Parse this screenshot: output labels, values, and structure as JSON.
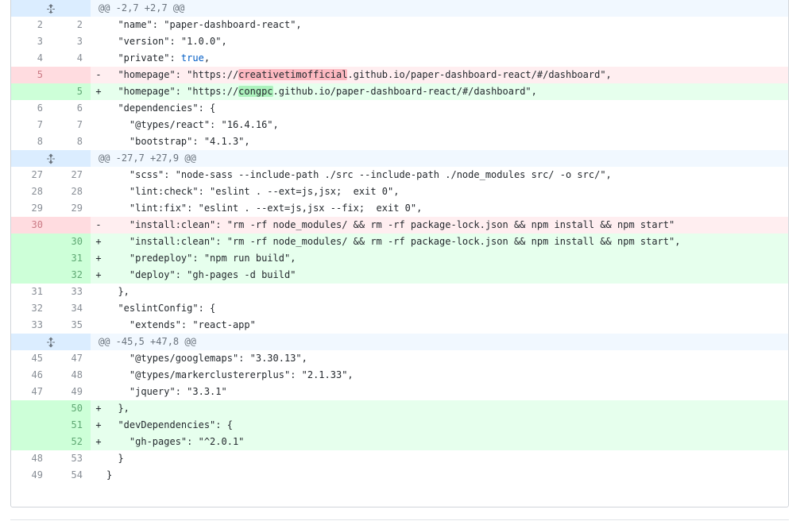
{
  "hunks": [
    {
      "header": "@@ -2,7 +2,7 @@",
      "expand_icon": "unfold-up-icon",
      "lines": [
        {
          "type": "ctx",
          "old": "2",
          "new": "2",
          "code": "  \"name\": \"paper-dashboard-react\","
        },
        {
          "type": "ctx",
          "old": "3",
          "new": "3",
          "code": "  \"version\": \"1.0.0\","
        },
        {
          "type": "ctx",
          "old": "4",
          "new": "4",
          "code": "  \"private\": true,"
        },
        {
          "type": "del",
          "old": "5",
          "new": "",
          "pre": "  \"homepage\": \"https://",
          "word": "creativetimofficial",
          "post": ".github.io/paper-dashboard-react/#/dashboard\","
        },
        {
          "type": "add",
          "old": "",
          "new": "5",
          "pre": "  \"homepage\": \"https://",
          "word": "congpc",
          "post": ".github.io/paper-dashboard-react/#/dashboard\","
        },
        {
          "type": "ctx",
          "old": "6",
          "new": "6",
          "code": "  \"dependencies\": {"
        },
        {
          "type": "ctx",
          "old": "7",
          "new": "7",
          "code": "    \"@types/react\": \"16.4.16\","
        },
        {
          "type": "ctx",
          "old": "8",
          "new": "8",
          "code": "    \"bootstrap\": \"4.1.3\","
        }
      ]
    },
    {
      "header": "@@ -27,7 +27,9 @@",
      "expand_icon": "unfold-icon",
      "lines": [
        {
          "type": "ctx",
          "old": "27",
          "new": "27",
          "code": "    \"scss\": \"node-sass --include-path ./src --include-path ./node_modules src/ -o src/\","
        },
        {
          "type": "ctx",
          "old": "28",
          "new": "28",
          "code": "    \"lint:check\": \"eslint . --ext=js,jsx;  exit 0\","
        },
        {
          "type": "ctx",
          "old": "29",
          "new": "29",
          "code": "    \"lint:fix\": \"eslint . --ext=js,jsx --fix;  exit 0\","
        },
        {
          "type": "del",
          "old": "30",
          "new": "",
          "code": "    \"install:clean\": \"rm -rf node_modules/ && rm -rf package-lock.json && npm install && npm start\""
        },
        {
          "type": "add",
          "old": "",
          "new": "30",
          "code": "    \"install:clean\": \"rm -rf node_modules/ && rm -rf package-lock.json && npm install && npm start\","
        },
        {
          "type": "add",
          "old": "",
          "new": "31",
          "code": "    \"predeploy\": \"npm run build\","
        },
        {
          "type": "add",
          "old": "",
          "new": "32",
          "code": "    \"deploy\": \"gh-pages -d build\""
        },
        {
          "type": "ctx",
          "old": "31",
          "new": "33",
          "code": "  },"
        },
        {
          "type": "ctx",
          "old": "32",
          "new": "34",
          "code": "  \"eslintConfig\": {"
        },
        {
          "type": "ctx",
          "old": "33",
          "new": "35",
          "code": "    \"extends\": \"react-app\""
        }
      ]
    },
    {
      "header": "@@ -45,5 +47,8 @@",
      "expand_icon": "unfold-icon",
      "lines": [
        {
          "type": "ctx",
          "old": "45",
          "new": "47",
          "code": "    \"@types/googlemaps\": \"3.30.13\","
        },
        {
          "type": "ctx",
          "old": "46",
          "new": "48",
          "code": "    \"@types/markerclustererplus\": \"2.1.33\","
        },
        {
          "type": "ctx",
          "old": "47",
          "new": "49",
          "code": "    \"jquery\": \"3.3.1\""
        },
        {
          "type": "add",
          "old": "",
          "new": "50",
          "code": "  },"
        },
        {
          "type": "add",
          "old": "",
          "new": "51",
          "code": "  \"devDependencies\": {"
        },
        {
          "type": "add",
          "old": "",
          "new": "52",
          "code": "    \"gh-pages\": \"^2.0.1\""
        },
        {
          "type": "ctx",
          "old": "48",
          "new": "53",
          "code": "  }"
        },
        {
          "type": "ctx",
          "old": "49",
          "new": "54",
          "code": "}"
        }
      ]
    }
  ],
  "markers": {
    "add": "+",
    "del": "-",
    "ctx": " "
  },
  "colors": {
    "add_bg": "#e6ffed",
    "del_bg": "#ffeef0",
    "hunk_bg": "#f1f8ff",
    "word_del": "#fdb8c0",
    "word_add": "#acf2bd"
  }
}
